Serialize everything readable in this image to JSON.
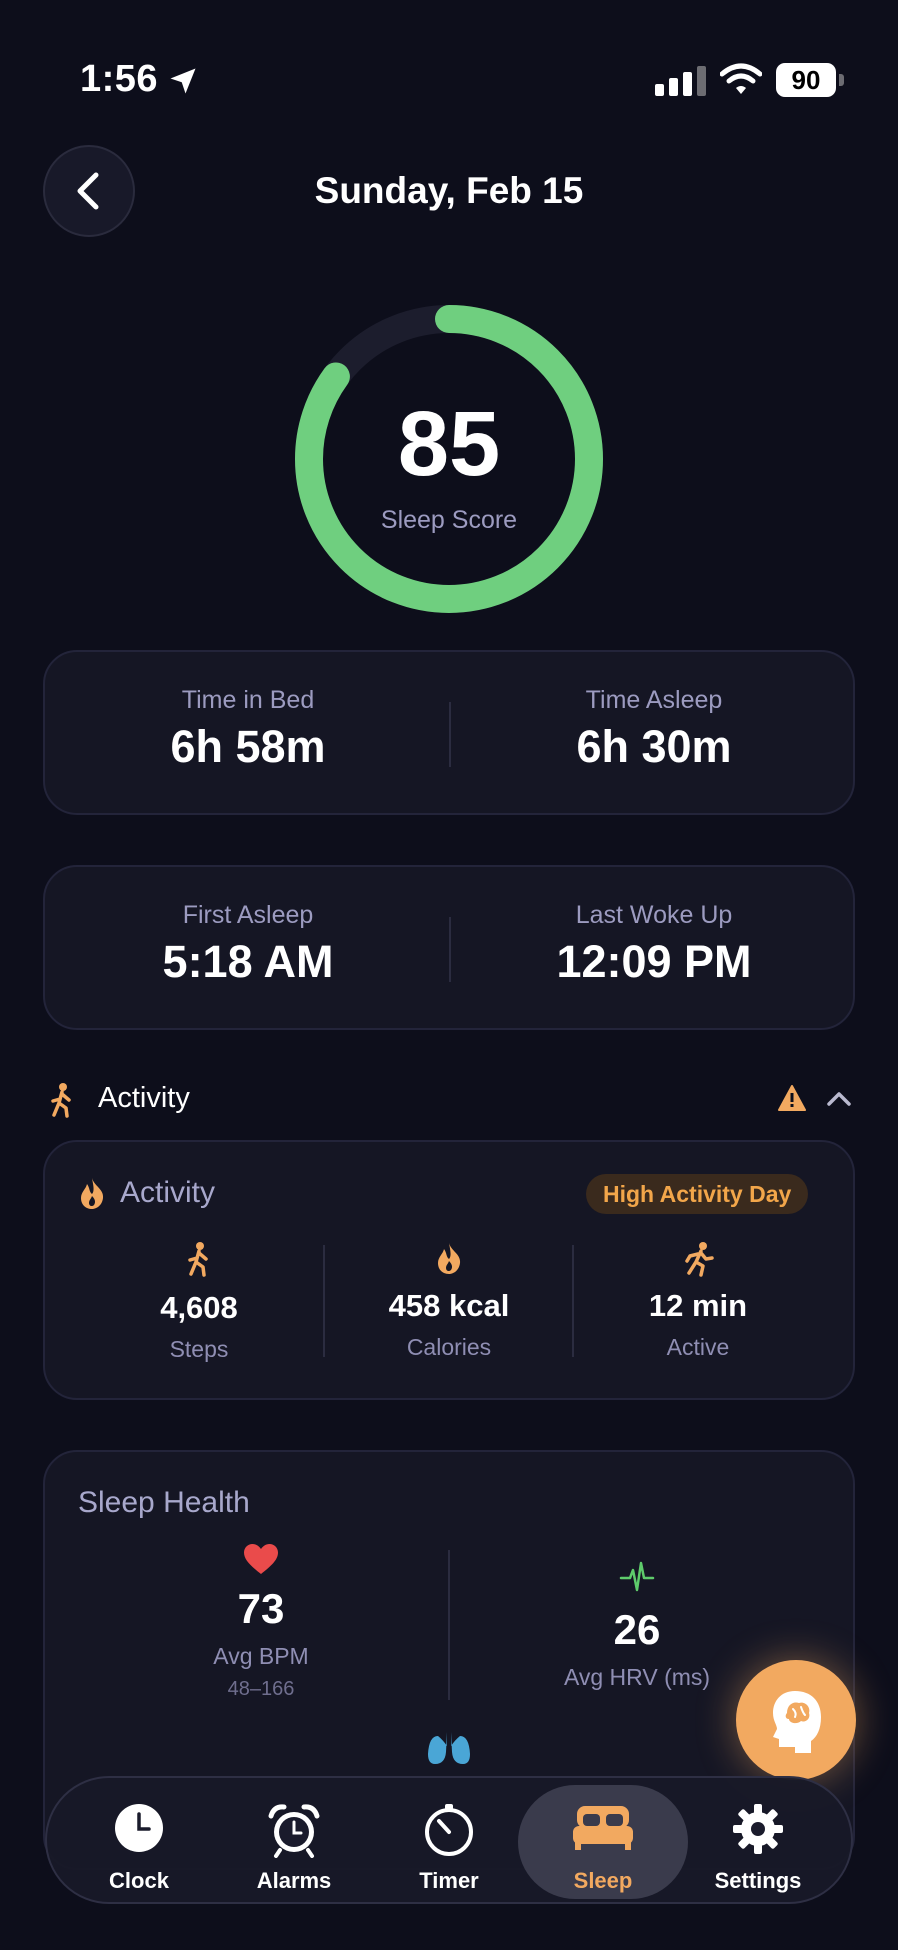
{
  "status_bar": {
    "time": "1:56",
    "battery": "90"
  },
  "header": {
    "title": "Sunday, Feb 15"
  },
  "score": {
    "value": "85",
    "label": "Sleep Score",
    "fraction": 0.85
  },
  "bed_stats": {
    "time_in_bed_label": "Time in Bed",
    "time_in_bed": "6h 58m",
    "time_asleep_label": "Time Asleep",
    "time_asleep": "6h 30m"
  },
  "wake_stats": {
    "first_asleep_label": "First Asleep",
    "first_asleep": "5:18 AM",
    "last_woke_label": "Last Woke Up",
    "last_woke": "12:09 PM"
  },
  "activity_section": {
    "title": "Activity"
  },
  "activity_card": {
    "title": "Activity",
    "badge": "High Activity Day",
    "steps_value": "4,608",
    "steps_label": "Steps",
    "calories_value": "458 kcal",
    "calories_label": "Calories",
    "active_value": "12 min",
    "active_label": "Active"
  },
  "sleep_health": {
    "title": "Sleep Health",
    "bpm_value": "73",
    "bpm_label": "Avg BPM",
    "bpm_range": "48–166",
    "hrv_value": "26",
    "hrv_label": "Avg HRV (ms)"
  },
  "tabs": [
    {
      "label": "Clock"
    },
    {
      "label": "Alarms"
    },
    {
      "label": "Timer"
    },
    {
      "label": "Sleep"
    },
    {
      "label": "Settings"
    }
  ],
  "colors": {
    "accent": "#f2a960",
    "score_green": "#6fcf7f",
    "heart_red": "#ea4b4b",
    "hrv_green": "#5ecb6b"
  }
}
